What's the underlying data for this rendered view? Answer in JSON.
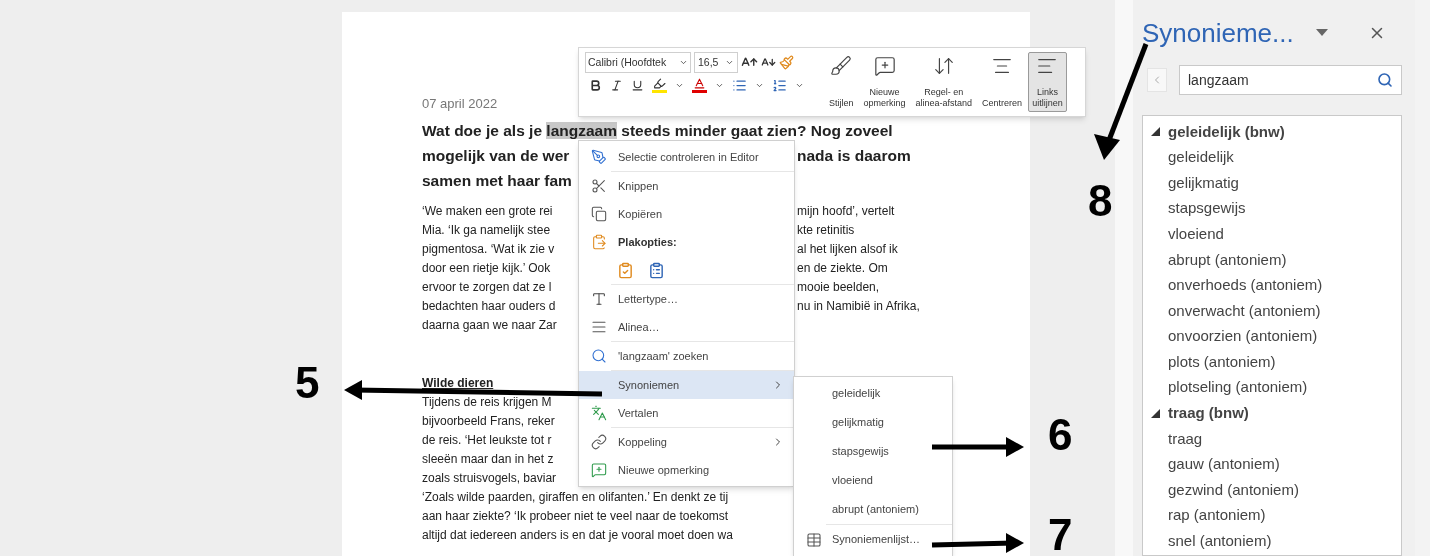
{
  "document": {
    "date": "07 april 2022",
    "title_first_line": {
      "before": "Wat doe je als je ",
      "selection": "langzaam",
      "after": " steeds minder gaat zien? Nog zoveel"
    },
    "title_lines": [
      {
        "left": "mogelijk van de wer",
        "right": "nada is daarom"
      },
      {
        "left": "samen met haar fam"
      }
    ],
    "intro_lines": [
      {
        "left": "‘We maken een grote rei",
        "right": "mijn hoofd’, vertelt"
      },
      {
        "left": "Mia. ‘Ik ga namelijk stee",
        "right": "kte retinitis"
      },
      {
        "left": "pigmentosa. ‘Wat ik zie v",
        "right": "al het lijken alsof ik"
      },
      {
        "left": "door een rietje kijk.’ Ook",
        "right": "en de ziekte. Om"
      },
      {
        "left": "ervoor te zorgen dat ze l",
        "right": "mooie beelden,"
      },
      {
        "left": "bedachten haar ouders d",
        "right": "nu in Namibië in Afrika,"
      },
      {
        "left": "daarna gaan we naar Zar"
      }
    ],
    "section_title": "Wilde dieren",
    "section_lines": [
      {
        "left": "Tijdens de reis krijgen M"
      },
      {
        "left": "bijvoorbeeld Frans, reker"
      },
      {
        "left": "de reis. ‘Het leukste tot r"
      },
      {
        "left": "sleeën maar dan in het z"
      },
      {
        "left": "zoals struisvogels, baviar"
      },
      {
        "left": "‘Zoals wilde paarden, giraffen en olifanten.’ En denkt ze tij"
      },
      {
        "left": "aan haar ziekte? ‘Ik probeer niet te veel naar de toekomst"
      },
      {
        "left": "altijd dat iedereen anders is en dat je vooral moet doen wa"
      }
    ]
  },
  "mini_toolbar": {
    "font": "Calibri (Hoofdtek",
    "size": "16,5",
    "buttons": [
      {
        "label": [
          "Stijlen"
        ],
        "selected": false
      },
      {
        "label": [
          "Nieuwe",
          "opmerking"
        ],
        "selected": false
      },
      {
        "label": [
          "Regel- en",
          "alinea-afstand"
        ],
        "selected": false
      },
      {
        "label": [
          "Centreren"
        ],
        "selected": false
      },
      {
        "label": [
          "Links",
          "uitlijnen"
        ],
        "selected": true
      }
    ]
  },
  "context_menu": [
    {
      "kind": "item",
      "label": "Selectie controleren in Editor",
      "selected": false,
      "submenu": false
    },
    {
      "kind": "item",
      "label": "Knippen",
      "selected": false,
      "submenu": false
    },
    {
      "kind": "item",
      "label": "Kopiëren",
      "selected": false,
      "submenu": false
    },
    {
      "kind": "header",
      "label": "Plakopties:"
    },
    {
      "kind": "paste_options"
    },
    {
      "kind": "item",
      "label": "Lettertype…",
      "selected": false,
      "submenu": false
    },
    {
      "kind": "item",
      "label": "Alinea…",
      "selected": false,
      "submenu": false
    },
    {
      "kind": "item",
      "label": "'langzaam' zoeken",
      "selected": false,
      "submenu": false
    },
    {
      "kind": "item",
      "label": "Synoniemen",
      "selected": true,
      "submenu": true
    },
    {
      "kind": "item",
      "label": "Vertalen",
      "selected": false,
      "submenu": false
    },
    {
      "kind": "item",
      "label": "Koppeling",
      "selected": false,
      "submenu": true
    },
    {
      "kind": "item",
      "label": "Nieuwe opmerking",
      "selected": false,
      "submenu": false
    }
  ],
  "submenu": [
    {
      "label": "geleidelijk"
    },
    {
      "label": "gelijkmatig"
    },
    {
      "label": "stapsgewijs"
    },
    {
      "label": "vloeiend"
    },
    {
      "label": "abrupt (antoniem)"
    },
    {
      "label": "Synoniemenlijst…"
    }
  ],
  "synonyms_pane": {
    "title": "Synonieme...",
    "search_value": "langzaam",
    "groups": [
      {
        "label": "geleidelijk (bnw)",
        "expanded": true,
        "children": [
          {
            "label": "geleidelijk"
          },
          {
            "label": "gelijkmatig"
          },
          {
            "label": "stapsgewijs"
          },
          {
            "label": "vloeiend"
          },
          {
            "label": "abrupt (antoniem)"
          },
          {
            "label": "onverhoeds (antoniem)"
          },
          {
            "label": "onverwacht (antoniem)"
          },
          {
            "label": "onvoorzien (antoniem)"
          },
          {
            "label": "plots (antoniem)"
          },
          {
            "label": "plotseling (antoniem)"
          }
        ]
      },
      {
        "label": "traag (bnw)",
        "expanded": true,
        "children": [
          {
            "label": "traag"
          },
          {
            "label": "gauw (antoniem)"
          },
          {
            "label": "gezwind (antoniem)"
          },
          {
            "label": "rap (antoniem)"
          },
          {
            "label": "snel (antoniem)"
          }
        ]
      }
    ]
  },
  "annotations": [
    {
      "label": "8"
    },
    {
      "label": "5"
    },
    {
      "label": "6"
    },
    {
      "label": "7"
    }
  ]
}
